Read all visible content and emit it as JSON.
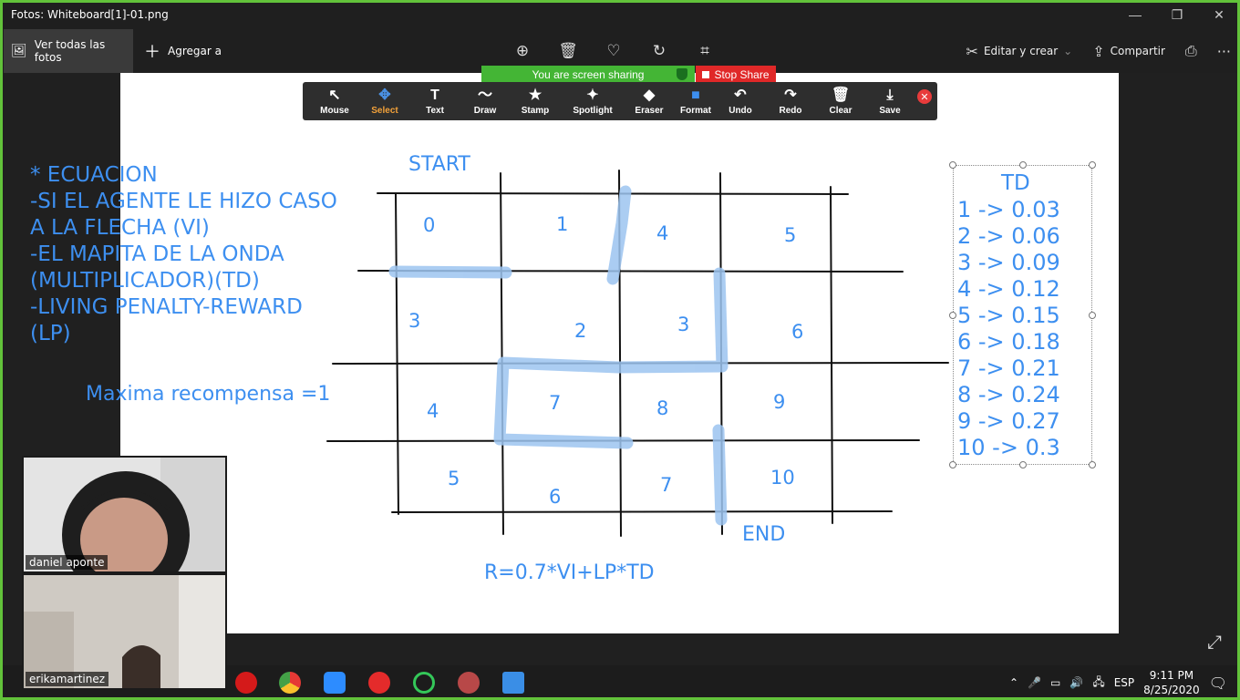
{
  "window": {
    "title": "Fotos: Whiteboard[1]-01.png",
    "controls": [
      "—",
      "❐",
      "✕"
    ]
  },
  "toolbar": {
    "all_photos": "Ver todas las fotos",
    "add_to": "Agregar a",
    "edit_create": "Editar y crear",
    "share": "Compartir"
  },
  "zoom": {
    "sharing_banner": "You are screen sharing",
    "stop_share": "Stop Share",
    "annotation_tools": [
      {
        "label": "Mouse",
        "icon": "↖"
      },
      {
        "label": "Select",
        "icon": "✥"
      },
      {
        "label": "Text",
        "icon": "T"
      },
      {
        "label": "Draw",
        "icon": "〜"
      },
      {
        "label": "Stamp",
        "icon": "★"
      },
      {
        "label": "Spotlight",
        "icon": "✦"
      },
      {
        "label": "Eraser",
        "icon": "◆"
      },
      {
        "label": "Format",
        "icon": "■"
      },
      {
        "label": "Undo",
        "icon": "↶"
      },
      {
        "label": "Redo",
        "icon": "↷"
      },
      {
        "label": "Clear",
        "icon": "🗑"
      },
      {
        "label": "Save",
        "icon": "⤓"
      }
    ],
    "active_tool": "Select"
  },
  "whiteboard": {
    "notes": [
      "* ECUACION",
      "-SI EL AGENTE LE HIZO CASO",
      "A LA FLECHA (VI)",
      "-EL MAPITA DE LA ONDA",
      "(MULTIPLICADOR)(TD)",
      "-LIVING PENALTY-REWARD",
      "(LP)"
    ],
    "max_reward": "Maxima recompensa =1",
    "start": "START",
    "end": "END",
    "formula": "R=0.7*VI+LP*TD",
    "grid_numbers": [
      [
        "0",
        "1",
        "4",
        "5"
      ],
      [
        "3",
        "2",
        "3",
        "6"
      ],
      [
        "4",
        "7",
        "8",
        "9"
      ],
      [
        "5",
        "6",
        "7",
        "10"
      ]
    ],
    "td_title": "TD",
    "td_list": [
      "1 -> 0.03",
      "2 -> 0.06",
      "3 -> 0.09",
      "4 -> 0.12",
      "5 -> 0.15",
      "6 -> 0.18",
      "7 -> 0.21",
      "8 -> 0.24",
      "9 -> 0.27",
      "10 -> 0.3"
    ],
    "ink_color": "#3d8ff0",
    "path_color": "#9cc4f0"
  },
  "participants": [
    {
      "name": "daniel aponte"
    },
    {
      "name": "erikamartinez"
    }
  ],
  "tray": {
    "language": "ESP",
    "time": "9:11 PM",
    "date": "8/25/2020"
  }
}
